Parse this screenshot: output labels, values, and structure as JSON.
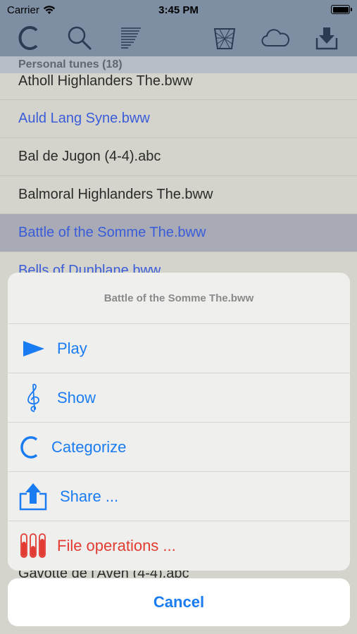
{
  "status": {
    "carrier": "Carrier",
    "time": "3:45 PM"
  },
  "toolbar": {
    "icons": [
      "categorize-icon",
      "search-icon",
      "list-icon",
      "trash-icon",
      "cloud-icon",
      "download-icon"
    ]
  },
  "section": {
    "title": "Personal tunes (18)"
  },
  "list": {
    "rows": [
      {
        "label": "Atholl Highlanders The.bww"
      },
      {
        "label": "Auld Lang Syne.bww"
      },
      {
        "label": "Bal de Jugon (4-4).abc"
      },
      {
        "label": "Balmoral Highlanders The.bww"
      },
      {
        "label": "Battle of the Somme The.bww"
      }
    ],
    "peek_top": "Bells of Dunblane.bww",
    "peek_bottom": "Gavotte de l'Aven (4-4).abc"
  },
  "sheet": {
    "title": "Battle of the Somme The.bww",
    "actions": [
      {
        "label": "Play",
        "icon": "play-icon"
      },
      {
        "label": "Show",
        "icon": "treble-clef-icon"
      },
      {
        "label": "Categorize",
        "icon": "categorize-icon"
      },
      {
        "label": "Share ...",
        "icon": "share-icon"
      },
      {
        "label": "File operations ...",
        "icon": "file-operations-icon"
      }
    ],
    "cancel": "Cancel"
  },
  "colors": {
    "accent": "#1a7cf2",
    "destructive": "#e23b32",
    "toolbar": "#7e8ea3",
    "link": "#3a5cd8"
  }
}
